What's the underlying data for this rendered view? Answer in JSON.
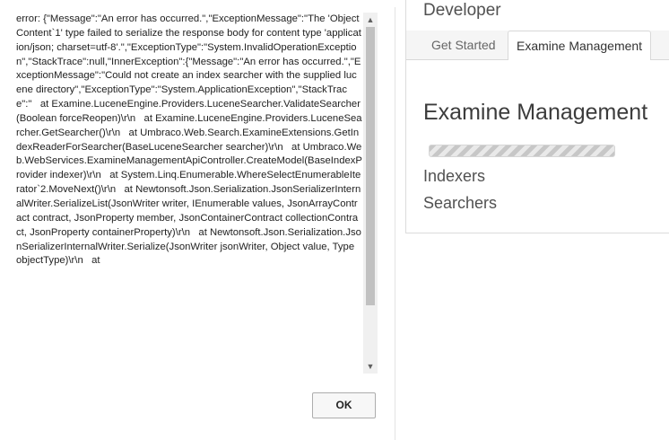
{
  "dialog": {
    "error_text": "error: {\"Message\":\"An error has occurred.\",\"ExceptionMessage\":\"The 'ObjectContent`1' type failed to serialize the response body for content type 'application/json; charset=utf-8'.\",\"ExceptionType\":\"System.InvalidOperationException\",\"StackTrace\":null,\"InnerException\":{\"Message\":\"An error has occurred.\",\"ExceptionMessage\":\"Could not create an index searcher with the supplied lucene directory\",\"ExceptionType\":\"System.ApplicationException\",\"StackTrace\":\"   at Examine.LuceneEngine.Providers.LuceneSearcher.ValidateSearcher(Boolean forceReopen)\\r\\n   at Examine.LuceneEngine.Providers.LuceneSearcher.GetSearcher()\\r\\n   at Umbraco.Web.Search.ExamineExtensions.GetIndexReaderForSearcher(BaseLuceneSearcher searcher)\\r\\n   at Umbraco.Web.WebServices.ExamineManagementApiController.CreateModel(BaseIndexProvider indexer)\\r\\n   at System.Linq.Enumerable.WhereSelectEnumerableIterator`2.MoveNext()\\r\\n   at Newtonsoft.Json.Serialization.JsonSerializerInternalWriter.SerializeList(JsonWriter writer, IEnumerable values, JsonArrayContract contract, JsonProperty member, JsonContainerContract collectionContract, JsonProperty containerProperty)\\r\\n   at Newtonsoft.Json.Serialization.JsonSerializerInternalWriter.Serialize(JsonWriter jsonWriter, Object value, Type objectType)\\r\\n   at",
    "ok_label": "OK"
  },
  "panel": {
    "section_title": "Developer",
    "tabs": [
      {
        "label": "Get Started"
      },
      {
        "label": "Examine Management"
      }
    ],
    "page_title": "Examine Management",
    "progress_fraction": 1.0,
    "links": [
      {
        "label": "Indexers"
      },
      {
        "label": "Searchers"
      }
    ]
  },
  "colors": {
    "ok_button_bg": "#f7f7f7",
    "progress_stripe_dark": "#c7c7c7",
    "progress_stripe_light": "#e9e9e9",
    "tabs_bg": "#f5f5f5"
  }
}
